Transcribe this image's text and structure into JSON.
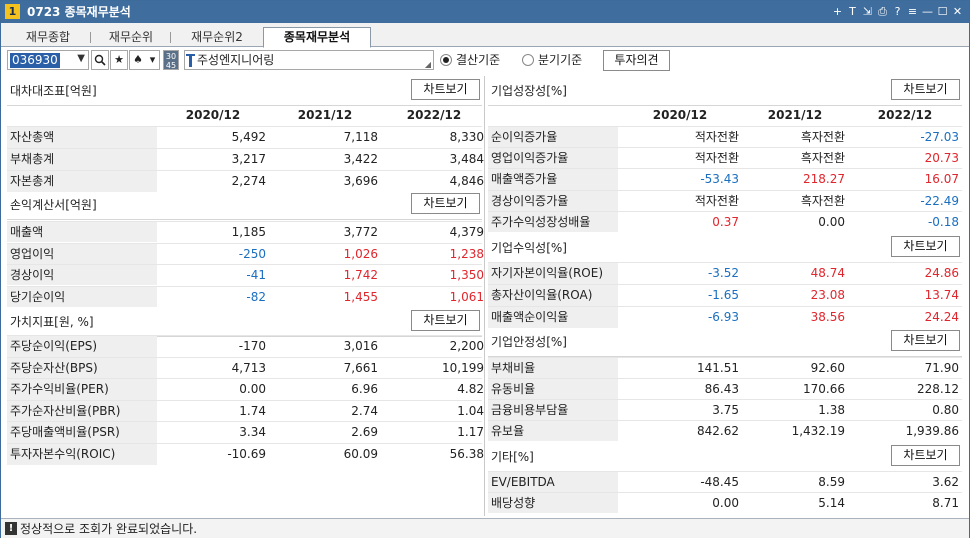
{
  "window": {
    "number": "1",
    "title": "0723 종목재무분석",
    "controls": [
      "+",
      "T",
      "⇲",
      "⎙",
      "?",
      "≡",
      "—",
      "☐",
      "✕"
    ]
  },
  "tabs": [
    "재무종합",
    "재무순위",
    "재무순위2",
    "종목재무분석"
  ],
  "toolbar": {
    "code": "036930",
    "icons": [
      "search-icon",
      "star-icon",
      "spade-icon",
      "dropdown-icon"
    ],
    "small_label": "30\n45",
    "company": "주성엔지니어링",
    "radio_settle": "결산기준",
    "radio_quarter": "분기기준",
    "invest_button": "투자의견"
  },
  "chart_btn": "차트보기",
  "years": [
    "2020/12",
    "2021/12",
    "2022/12"
  ],
  "left": {
    "balance": {
      "title": "대차대조표[억원]",
      "rows": [
        {
          "label": "자산총액",
          "values": [
            "5,492",
            "7,118",
            "8,330"
          ]
        },
        {
          "label": "부채총계",
          "values": [
            "3,217",
            "3,422",
            "3,484"
          ]
        },
        {
          "label": "자본총계",
          "values": [
            "2,274",
            "3,696",
            "4,846"
          ]
        }
      ]
    },
    "income": {
      "title": "손익계산서[억원]",
      "rows": [
        {
          "label": "매출액",
          "values": [
            "1,185",
            "3,772",
            "4,379"
          ]
        },
        {
          "label": "영업이익",
          "values": [
            "-250",
            "1,026",
            "1,238"
          ]
        },
        {
          "label": "경상이익",
          "values": [
            "-41",
            "1,742",
            "1,350"
          ]
        },
        {
          "label": "당기순이익",
          "values": [
            "-82",
            "1,455",
            "1,061"
          ]
        }
      ]
    },
    "value": {
      "title": "가치지표[원, %]",
      "rows": [
        {
          "label": "주당순이익(EPS)",
          "values": [
            "-170",
            "3,016",
            "2,200"
          ]
        },
        {
          "label": "주당순자산(BPS)",
          "values": [
            "4,713",
            "7,661",
            "10,199"
          ]
        },
        {
          "label": "주가수익비율(PER)",
          "values": [
            "0.00",
            "6.96",
            "4.82"
          ]
        },
        {
          "label": "주가순자산비율(PBR)",
          "values": [
            "1.74",
            "2.74",
            "1.04"
          ]
        },
        {
          "label": "주당매출액비율(PSR)",
          "values": [
            "3.34",
            "2.69",
            "1.17"
          ]
        },
        {
          "label": "투자자본수익(ROIC)",
          "values": [
            "-10.69",
            "60.09",
            "56.38"
          ]
        }
      ]
    }
  },
  "right": {
    "growth": {
      "title": "기업성장성[%]",
      "rows": [
        {
          "label": "순이익증가율",
          "values": [
            "적자전환",
            "흑자전환",
            "-27.03"
          ]
        },
        {
          "label": "영업이익증가율",
          "values": [
            "적자전환",
            "흑자전환",
            "20.73"
          ]
        },
        {
          "label": "매출액증가율",
          "values": [
            "-53.43",
            "218.27",
            "16.07"
          ]
        },
        {
          "label": "경상이익증가율",
          "values": [
            "적자전환",
            "흑자전환",
            "-22.49"
          ]
        },
        {
          "label": "주가수익성장성배율",
          "values": [
            "0.37",
            "0.00",
            "-0.18"
          ]
        }
      ]
    },
    "profit": {
      "title": "기업수익성[%]",
      "rows": [
        {
          "label": "자기자본이익율(ROE)",
          "values": [
            "-3.52",
            "48.74",
            "24.86"
          ]
        },
        {
          "label": "총자산이익율(ROA)",
          "values": [
            "-1.65",
            "23.08",
            "13.74"
          ]
        },
        {
          "label": "매출액순이익율",
          "values": [
            "-6.93",
            "38.56",
            "24.24"
          ]
        }
      ]
    },
    "stability": {
      "title": "기업안정성[%]",
      "rows": [
        {
          "label": "부채비율",
          "values": [
            "141.51",
            "92.60",
            "71.90"
          ]
        },
        {
          "label": "유동비율",
          "values": [
            "86.43",
            "170.66",
            "228.12"
          ]
        },
        {
          "label": "금융비용부담율",
          "values": [
            "3.75",
            "1.38",
            "0.80"
          ]
        },
        {
          "label": "유보율",
          "values": [
            "842.62",
            "1,432.19",
            "1,939.86"
          ]
        }
      ]
    },
    "etc": {
      "title": "기타[%]",
      "rows": [
        {
          "label": "EV/EBITDA",
          "values": [
            "-48.45",
            "8.59",
            "3.62"
          ]
        },
        {
          "label": "배당성향",
          "values": [
            "0.00",
            "5.14",
            "8.71"
          ]
        }
      ]
    }
  },
  "colors": {
    "up": "#e0262d",
    "down": "#1a6fc0",
    "title_bar": "#3f6e9e"
  },
  "status": {
    "icon": "!",
    "message": "정상적으로 조회가 완료되었습니다."
  }
}
